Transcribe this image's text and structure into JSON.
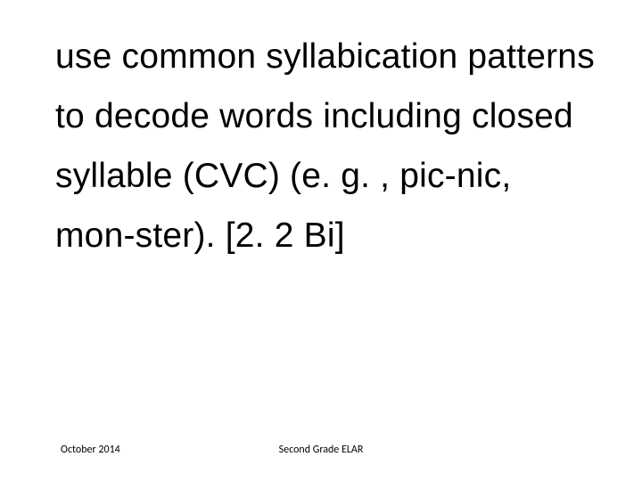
{
  "body": {
    "text": "use common syllabication patterns to decode words including closed syllable (CVC) (e. g. , pic-nic, mon-ster). [2. 2 Bi]"
  },
  "footer": {
    "left": "October 2014",
    "center": "Second Grade ELAR"
  }
}
